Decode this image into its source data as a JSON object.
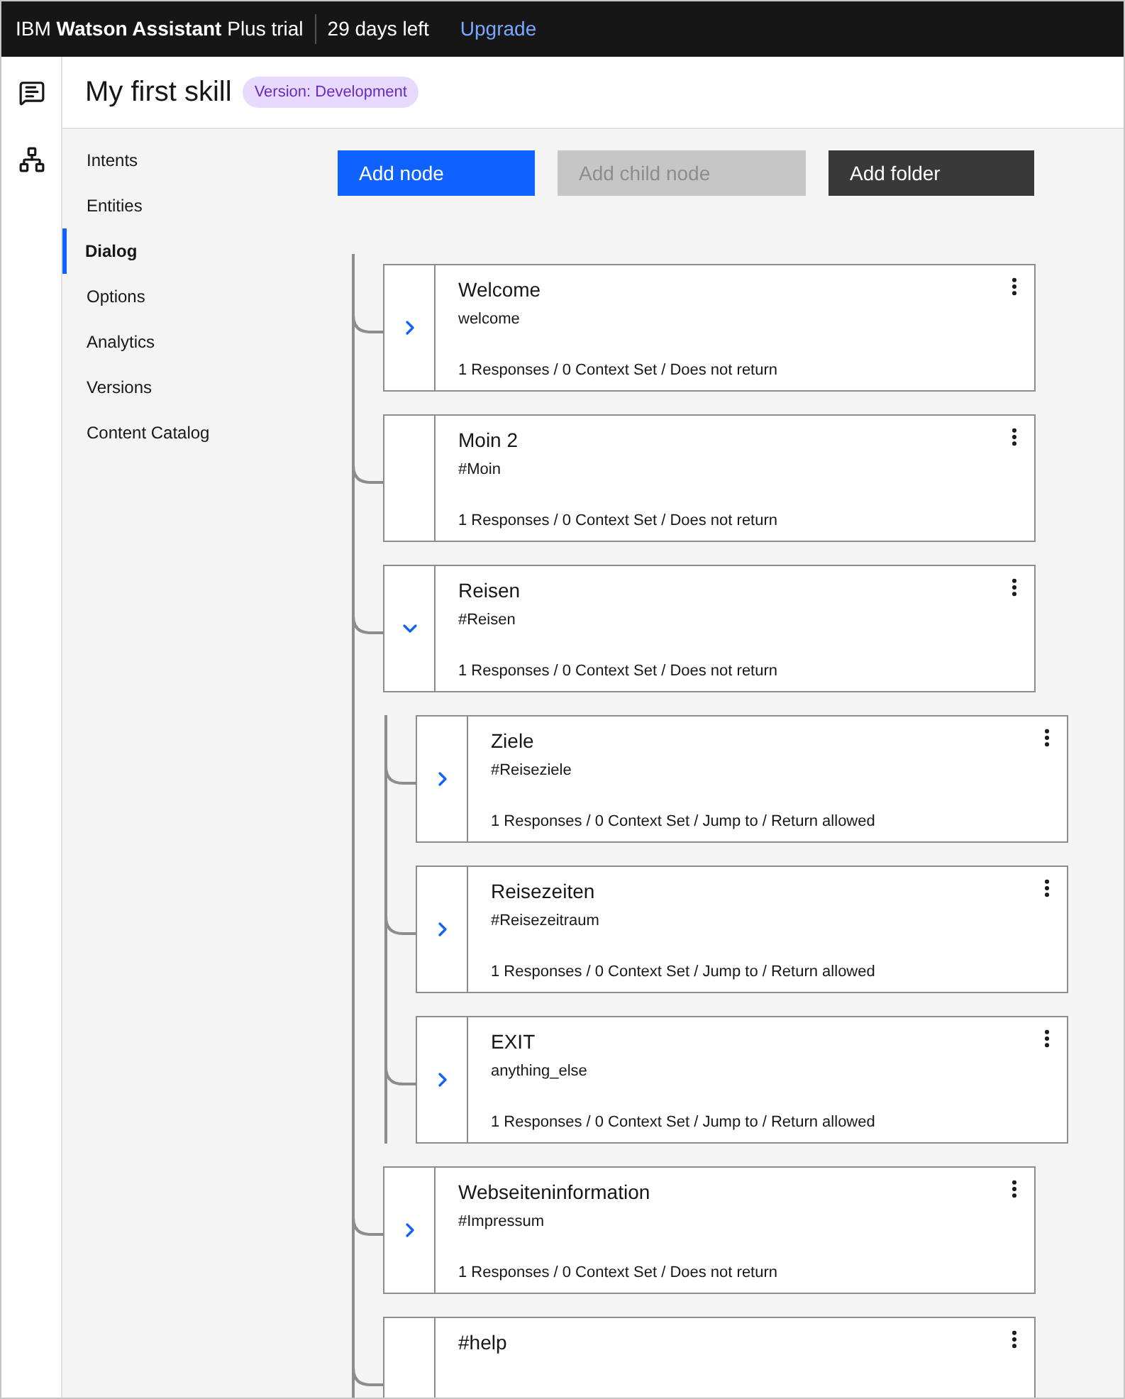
{
  "top_bar": {
    "product": "IBM **Watson Assistant** Plus trial",
    "trial_status": "29 days left",
    "upgrade_link": "Upgrade"
  },
  "header": {
    "title": "My first skill",
    "version_tag": "Version: Development"
  },
  "nav": {
    "items": [
      {
        "label": "Intents",
        "selected": false
      },
      {
        "label": "Entities",
        "selected": false
      },
      {
        "label": "Dialog",
        "selected": true
      },
      {
        "label": "Options",
        "selected": false
      },
      {
        "label": "Analytics",
        "selected": false
      },
      {
        "label": "Versions",
        "selected": false
      },
      {
        "label": "Content Catalog",
        "selected": false
      }
    ]
  },
  "toolbar": {
    "buttons": [
      {
        "label": "Add node",
        "kind": "primary",
        "disabled": false
      },
      {
        "label": "Add child node",
        "kind": "secondary",
        "disabled": true
      },
      {
        "label": "Add folder",
        "kind": "dark",
        "disabled": false
      }
    ]
  },
  "dialog_tree": {
    "nodes": [
      {
        "title": "Welcome",
        "condition": "welcome",
        "summary": "1 Responses / 0 Context Set / Does not return",
        "expandable": true,
        "expanded": false
      },
      {
        "title": "Moin 2",
        "condition": "#Moin",
        "summary": "1 Responses / 0 Context Set / Does not return",
        "expandable": false
      },
      {
        "title": "Reisen",
        "condition": "#Reisen",
        "summary": "1 Responses / 0 Context Set / Does not return",
        "expandable": true,
        "expanded": true,
        "children": [
          {
            "title": "Ziele",
            "condition": "#Reiseziele",
            "summary": "1 Responses / 0 Context Set / Jump to / Return allowed",
            "expandable": true,
            "expanded": false
          },
          {
            "title": "Reisezeiten",
            "condition": "#Reisezeitraum",
            "summary": "1 Responses / 0 Context Set / Jump to / Return allowed",
            "expandable": true,
            "expanded": false
          },
          {
            "title": "EXIT",
            "condition": "anything_else",
            "summary": "1 Responses / 0 Context Set / Jump to / Return allowed",
            "expandable": true,
            "expanded": false
          }
        ]
      },
      {
        "title": "Webseiteninformation",
        "condition": "#Impressum",
        "summary": "1 Responses / 0 Context Set / Does not return",
        "expandable": true,
        "expanded": false
      },
      {
        "title": "#help",
        "expandable": false
      }
    ]
  }
}
